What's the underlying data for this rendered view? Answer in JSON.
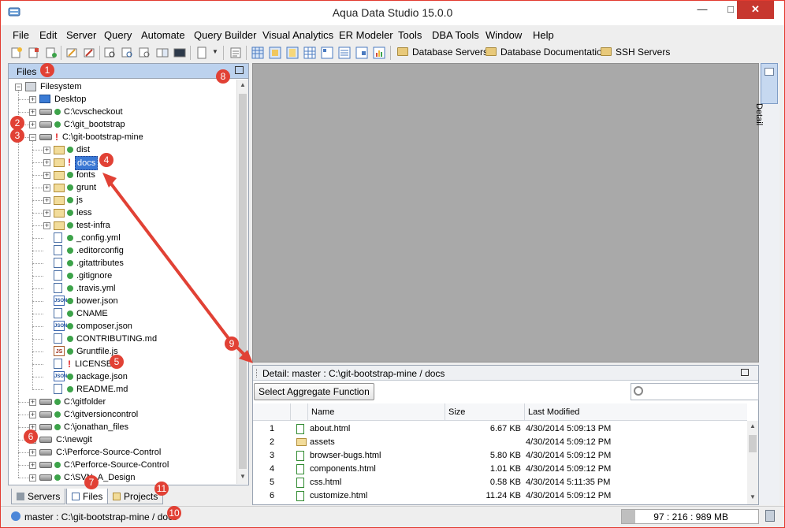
{
  "window": {
    "title": "Aqua Data Studio 15.0.0"
  },
  "menu": [
    "File",
    "Edit",
    "Server",
    "Query",
    "Automate",
    "Query Builder",
    "Visual Analytics",
    "ER Modeler",
    "Tools",
    "DBA Tools",
    "Window",
    "Help"
  ],
  "toolbar": {
    "links": [
      "Database Servers",
      "Database Documentation",
      "SSH Servers"
    ]
  },
  "files_panel": {
    "title": "Files",
    "tree": [
      {
        "label": "Filesystem",
        "icon": "filesystem-icon"
      },
      {
        "label": "Desktop",
        "icon": "desktop-icon"
      },
      {
        "label": "C:\\cvscheckout",
        "icon": "drive-icon",
        "status": "ok"
      },
      {
        "label": "C:\\git_bootstrap",
        "icon": "drive-icon",
        "status": "ok"
      },
      {
        "label": "C:\\git-bootstrap-mine",
        "icon": "drive-icon",
        "status": "modified"
      },
      {
        "label": "dist",
        "icon": "folder-icon",
        "status": "ok"
      },
      {
        "label": "docs",
        "icon": "folder-icon",
        "status": "modified",
        "selected": true
      },
      {
        "label": "fonts",
        "icon": "folder-icon",
        "status": "ok"
      },
      {
        "label": "grunt",
        "icon": "folder-icon",
        "status": "ok"
      },
      {
        "label": "js",
        "icon": "folder-icon",
        "status": "ok"
      },
      {
        "label": "less",
        "icon": "folder-icon",
        "status": "ok"
      },
      {
        "label": "test-infra",
        "icon": "folder-icon",
        "status": "ok"
      },
      {
        "label": "_config.yml",
        "icon": "file-icon",
        "status": "ok"
      },
      {
        "label": ".editorconfig",
        "icon": "file-icon",
        "status": "ok"
      },
      {
        "label": ".gitattributes",
        "icon": "file-icon",
        "status": "ok"
      },
      {
        "label": ".gitignore",
        "icon": "file-icon",
        "status": "ok"
      },
      {
        "label": ".travis.yml",
        "icon": "file-icon",
        "status": "ok"
      },
      {
        "label": "bower.json",
        "icon": "json-icon",
        "status": "ok"
      },
      {
        "label": "CNAME",
        "icon": "file-icon",
        "status": "ok"
      },
      {
        "label": "composer.json",
        "icon": "json-icon",
        "status": "ok"
      },
      {
        "label": "CONTRIBUTING.md",
        "icon": "file-icon",
        "status": "ok"
      },
      {
        "label": "Gruntfile.js",
        "icon": "js-icon",
        "status": "ok"
      },
      {
        "label": "LICENSE",
        "icon": "file-icon",
        "status": "modified"
      },
      {
        "label": "package.json",
        "icon": "json-icon",
        "status": "ok"
      },
      {
        "label": "README.md",
        "icon": "file-icon",
        "status": "ok"
      },
      {
        "label": "C:\\gitfolder",
        "icon": "drive-icon",
        "status": "ok"
      },
      {
        "label": "C:\\gitversioncontrol",
        "icon": "drive-icon",
        "status": "ok"
      },
      {
        "label": "C:\\jonathan_files",
        "icon": "drive-icon",
        "status": "ok"
      },
      {
        "label": "C:\\newgit",
        "icon": "drive-icon"
      },
      {
        "label": "C:\\Perforce-Source-Control",
        "icon": "drive-icon"
      },
      {
        "label": "C:\\Perforce-Source-Control",
        "icon": "drive-icon",
        "status": "ok"
      },
      {
        "label": "C:\\SVN_A_Design",
        "icon": "drive-icon",
        "status": "ok"
      }
    ]
  },
  "bottom_tabs": [
    "Servers",
    "Files",
    "Projects"
  ],
  "side_tab": {
    "label": "Detail"
  },
  "detail_panel": {
    "title": "Detail: master : C:\\git-bootstrap-mine / docs",
    "aggregate_button": "Select Aggregate Function",
    "columns": [
      "Name",
      "Size",
      "Last Modified"
    ],
    "rows": [
      {
        "num": "1",
        "type": "html-file-icon",
        "name": "about.html",
        "size": "6.67 KB",
        "modified": "4/30/2014 5:09:13 PM"
      },
      {
        "num": "2",
        "type": "folder-icon",
        "name": "assets",
        "size": "",
        "modified": "4/30/2014 5:09:12 PM"
      },
      {
        "num": "3",
        "type": "html-file-icon",
        "name": "browser-bugs.html",
        "size": "5.80 KB",
        "modified": "4/30/2014 5:09:12 PM"
      },
      {
        "num": "4",
        "type": "html-file-icon",
        "name": "components.html",
        "size": "1.01 KB",
        "modified": "4/30/2014 5:09:12 PM"
      },
      {
        "num": "5",
        "type": "html-file-icon",
        "name": "css.html",
        "size": "0.58 KB",
        "modified": "4/30/2014 5:11:35 PM"
      },
      {
        "num": "6",
        "type": "html-file-icon",
        "name": "customize.html",
        "size": "11.24 KB",
        "modified": "4/30/2014 5:09:12 PM"
      }
    ]
  },
  "status_bar": {
    "text": "master : C:\\git-bootstrap-mine / docs",
    "memory": "97 : 216 : 989 MB",
    "memory_used_fraction": 0.1
  },
  "annotations": [
    "1",
    "2",
    "3",
    "4",
    "5",
    "6",
    "7",
    "8",
    "9",
    "10",
    "11"
  ],
  "colors": {
    "accent": "#e14135",
    "selection": "#3a78d4",
    "header": "#bcd2ee",
    "work_area": "#a9a9a9"
  }
}
